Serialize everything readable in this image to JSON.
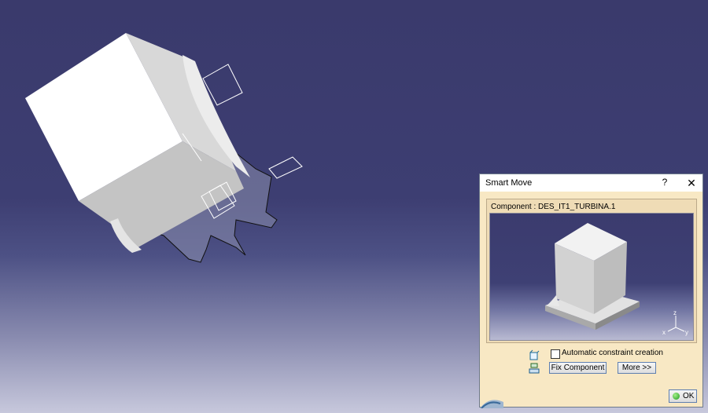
{
  "dialog": {
    "title": "Smart Move",
    "help_label": "?",
    "close_label": "✕",
    "component_label": "Component : DES_IT1_TURBINA.1",
    "checkbox_label": "Automatic constraint creation",
    "checkbox_checked": false,
    "fix_button_label": "Fix Component",
    "more_button_label": "More >>",
    "ok_button_label": "OK"
  },
  "preview_axes": {
    "z": "z",
    "x": "x",
    "y": "y"
  },
  "colors": {
    "viewport_top": "#3a3a6c",
    "dialog_bg": "#f8e8c4",
    "ok_green": "#1e9a1e"
  }
}
